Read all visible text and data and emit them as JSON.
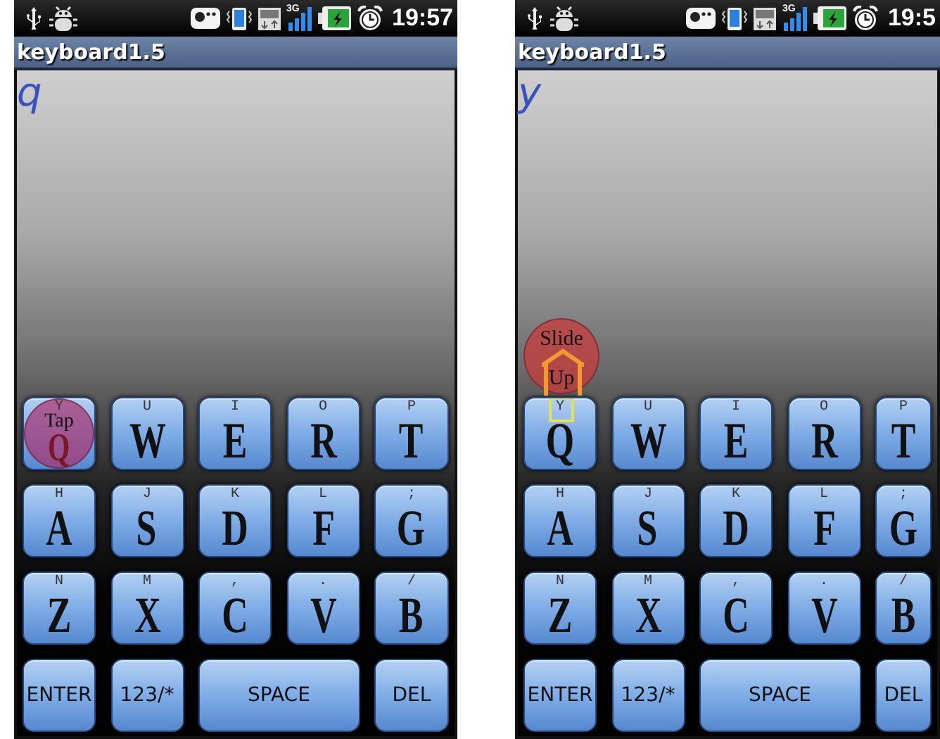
{
  "screens": [
    {
      "status_bar": {
        "network": "3G",
        "time": "19:57"
      },
      "app_title": "keyboard1.5",
      "typed_text": "q",
      "gesture": {
        "kind": "tap",
        "label_lines": [
          "Tap"
        ]
      },
      "key_rows": [
        [
          {
            "kind": "letter",
            "label": "Q",
            "alt": "Y"
          },
          {
            "kind": "letter",
            "label": "W",
            "alt": "U"
          },
          {
            "kind": "letter",
            "label": "E",
            "alt": "I"
          },
          {
            "kind": "letter",
            "label": "R",
            "alt": "O"
          },
          {
            "kind": "letter",
            "label": "T",
            "alt": "P"
          }
        ],
        [
          {
            "kind": "letter",
            "label": "A",
            "alt": "H"
          },
          {
            "kind": "letter",
            "label": "S",
            "alt": "J"
          },
          {
            "kind": "letter",
            "label": "D",
            "alt": "K"
          },
          {
            "kind": "letter",
            "label": "F",
            "alt": "L"
          },
          {
            "kind": "letter",
            "label": "G",
            "alt": ";"
          }
        ],
        [
          {
            "kind": "letter",
            "label": "Z",
            "alt": "N"
          },
          {
            "kind": "letter",
            "label": "X",
            "alt": "M"
          },
          {
            "kind": "letter",
            "label": "C",
            "alt": ","
          },
          {
            "kind": "letter",
            "label": "V",
            "alt": "."
          },
          {
            "kind": "letter",
            "label": "B",
            "alt": "/"
          }
        ],
        [
          {
            "kind": "function",
            "label": "ENTER"
          },
          {
            "kind": "function",
            "label": "123/*"
          },
          {
            "kind": "space",
            "label": "SPACE"
          },
          {
            "kind": "function",
            "label": "DEL"
          }
        ]
      ]
    },
    {
      "status_bar": {
        "network": "3G",
        "time": "19:5"
      },
      "app_title": "keyboard1.5",
      "typed_text": "y",
      "gesture": {
        "kind": "slide_up",
        "label_lines": [
          "Slide",
          "Up"
        ]
      },
      "key_rows": [
        [
          {
            "kind": "letter",
            "label": "Q",
            "alt": "Y"
          },
          {
            "kind": "letter",
            "label": "W",
            "alt": "U"
          },
          {
            "kind": "letter",
            "label": "E",
            "alt": "I"
          },
          {
            "kind": "letter",
            "label": "R",
            "alt": "O"
          },
          {
            "kind": "letter",
            "label": "T",
            "alt": "P"
          }
        ],
        [
          {
            "kind": "letter",
            "label": "A",
            "alt": "H"
          },
          {
            "kind": "letter",
            "label": "S",
            "alt": "J"
          },
          {
            "kind": "letter",
            "label": "D",
            "alt": "K"
          },
          {
            "kind": "letter",
            "label": "F",
            "alt": "L"
          },
          {
            "kind": "letter",
            "label": "G",
            "alt": ";"
          }
        ],
        [
          {
            "kind": "letter",
            "label": "Z",
            "alt": "N"
          },
          {
            "kind": "letter",
            "label": "X",
            "alt": "M"
          },
          {
            "kind": "letter",
            "label": "C",
            "alt": ","
          },
          {
            "kind": "letter",
            "label": "V",
            "alt": "."
          },
          {
            "kind": "letter",
            "label": "B",
            "alt": "/"
          }
        ],
        [
          {
            "kind": "function",
            "label": "ENTER"
          },
          {
            "kind": "function",
            "label": "123/*"
          },
          {
            "kind": "space",
            "label": "SPACE"
          },
          {
            "kind": "function",
            "label": "DEL"
          }
        ]
      ]
    }
  ]
}
